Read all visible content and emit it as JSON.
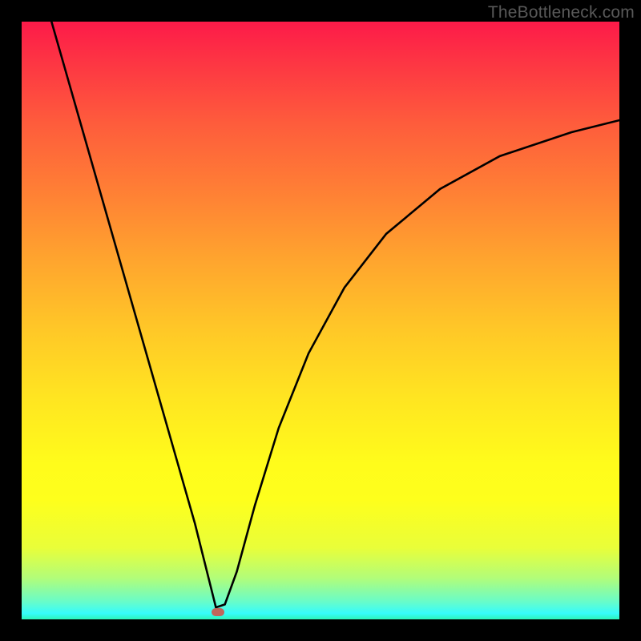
{
  "watermark": "TheBottleneck.com",
  "colors": {
    "border": "#000000",
    "curve_stroke": "#000000",
    "dot": "#c0655b",
    "gradient_top": "#fd1a49",
    "gradient_bottom": "#2df4b8"
  },
  "chart_data": {
    "type": "line",
    "title": "",
    "xlabel": "",
    "ylabel": "",
    "xlim": [
      0,
      100
    ],
    "ylim": [
      0,
      100
    ],
    "description": "Bottleneck curve: a single V-shaped black curve on a vertical rainbow gradient (red at top = bad fit, green at bottom = optimal). Minimum indicates the best-match configuration.",
    "series": [
      {
        "name": "bottleneck-curve",
        "x": [
          5,
          8,
          11,
          14,
          17,
          20,
          23,
          26,
          29,
          31.5,
          32.5,
          34,
          36,
          39,
          43,
          48,
          54,
          61,
          70,
          80,
          92,
          100
        ],
        "y": [
          100,
          89.5,
          79,
          68.5,
          58,
          47.5,
          37,
          26.5,
          16,
          6,
          2,
          2.5,
          8,
          19,
          32,
          44.5,
          55.5,
          64.5,
          72,
          77.5,
          81.5,
          83.5
        ]
      }
    ],
    "marker": {
      "x": 32.8,
      "y": 1.2,
      "label": "optimal-point"
    }
  }
}
